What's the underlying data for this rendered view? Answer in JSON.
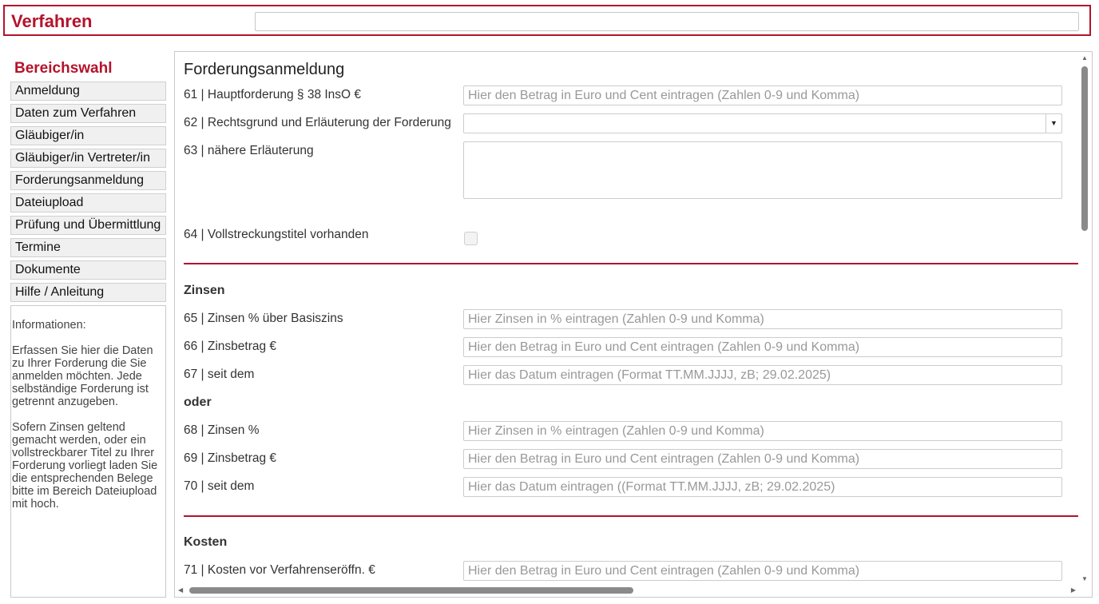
{
  "header": {
    "title": "Verfahren",
    "input_value": ""
  },
  "sidebar": {
    "title": "Bereichswahl",
    "items": [
      {
        "label": "Anmeldung"
      },
      {
        "label": "Daten zum Verfahren"
      },
      {
        "label": "Gläubiger/in"
      },
      {
        "label": "Gläubiger/in Vertreter/in"
      },
      {
        "label": "Forderungsanmeldung"
      },
      {
        "label": "Dateiupload"
      },
      {
        "label": "Prüfung und Übermittlung"
      },
      {
        "label": "Termine"
      },
      {
        "label": "Dokumente"
      },
      {
        "label": "Hilfe / Anleitung"
      }
    ],
    "info": {
      "heading": "Informationen:",
      "paragraph1": "Erfassen Sie hier die Daten zu Ihrer Forderung die Sie anmelden möchten. Jede selbständige Forderung ist getrennt anzugeben.",
      "paragraph2": "Sofern Zinsen geltend gemacht werden, oder ein vollstreckbarer Titel zu Ihrer Forderung vorliegt laden Sie die entsprechenden Belege bitte im Bereich Dateiupload mit hoch."
    }
  },
  "form": {
    "title": "Forderungsanmeldung",
    "f61": {
      "label": "61 | Hauptforderung § 38 InsO €",
      "placeholder": "Hier den Betrag in Euro und Cent eintragen (Zahlen 0-9 und Komma)"
    },
    "f62": {
      "label": "62 | Rechtsgrund und Erläuterung der Forderung",
      "value": ""
    },
    "f63": {
      "label": "63 | nähere Erläuterung"
    },
    "f64": {
      "label": "64 | Vollstreckungstitel vorhanden",
      "checked": false
    },
    "zinsen_heading": "Zinsen",
    "f65": {
      "label": "65 | Zinsen % über Basiszins",
      "placeholder": "Hier Zinsen in % eintragen (Zahlen 0-9 und Komma)"
    },
    "f66": {
      "label": "66 | Zinsbetrag €",
      "placeholder": "Hier den Betrag in Euro und Cent eintragen (Zahlen 0-9 und Komma)"
    },
    "f67": {
      "label": "67 | seit dem",
      "placeholder": "Hier das Datum eintragen (Format TT.MM.JJJJ, zB; 29.02.2025)"
    },
    "oder_heading": "oder",
    "f68": {
      "label": "68 | Zinsen %",
      "placeholder": "Hier Zinsen in % eintragen (Zahlen 0-9 und Komma)"
    },
    "f69": {
      "label": "69 | Zinsbetrag €",
      "placeholder": "Hier den Betrag in Euro und Cent eintragen (Zahlen 0-9 und Komma)"
    },
    "f70": {
      "label": "70 | seit dem",
      "placeholder": "Hier das Datum eintragen ((Format TT.MM.JJJJ, zB; 29.02.2025)"
    },
    "kosten_heading": "Kosten",
    "f71": {
      "label": "71 | Kosten vor Verfahrenseröffn. €",
      "placeholder": "Hier den Betrag in Euro und Cent eintragen (Zahlen 0-9 und Komma)"
    }
  },
  "colors": {
    "accent": "#b5132b",
    "placeholder": "#999999"
  },
  "icons": {
    "dropdown": "caret-down-icon",
    "scroll_up": "scroll-up-icon",
    "scroll_down": "scroll-down-icon",
    "scroll_left": "scroll-left-icon",
    "scroll_right": "scroll-right-icon"
  }
}
